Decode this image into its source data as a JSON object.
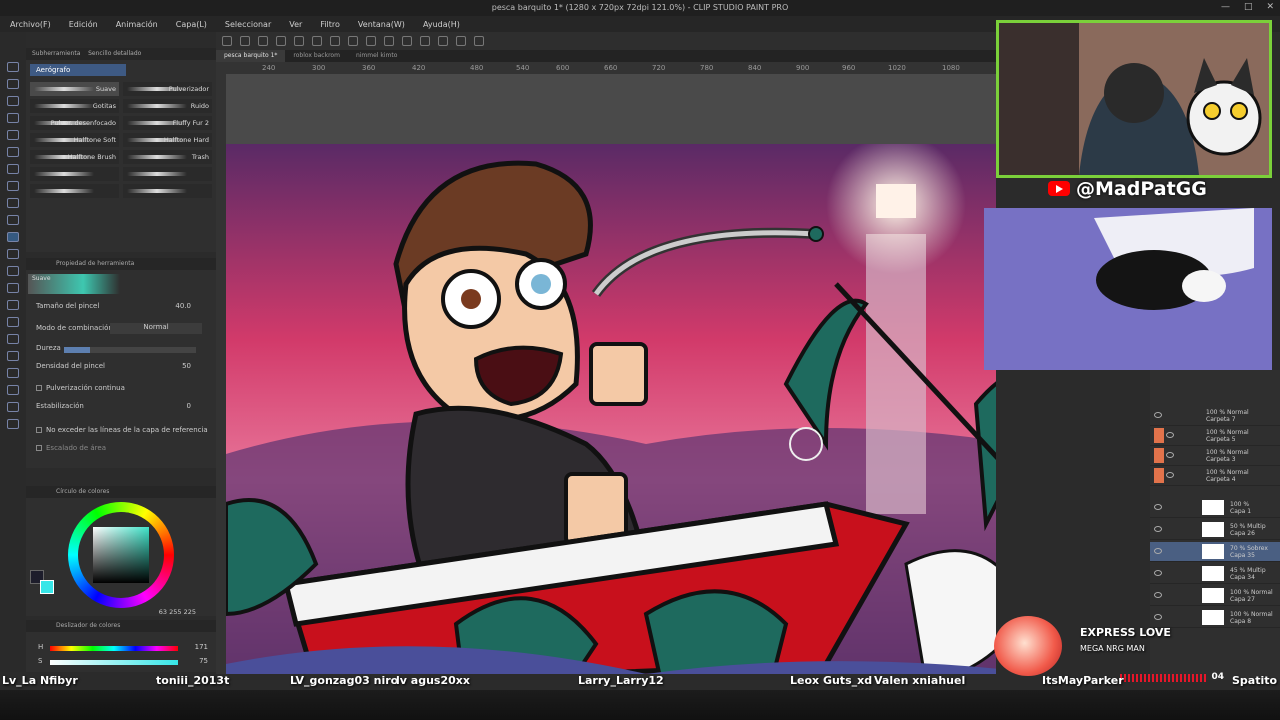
{
  "window": {
    "title": "pesca barquito 1* (1280 x 720px 72dpi 121.0%) - CLIP STUDIO PAINT PRO",
    "controls": [
      "—",
      "□",
      "✕"
    ]
  },
  "menu": [
    "Archivo(F)",
    "Edición",
    "Animación",
    "Capa(L)",
    "Seleccionar",
    "Ver",
    "Filtro",
    "Ventana(W)",
    "Ayuda(H)"
  ],
  "tabs": [
    "pesca barquito 1*",
    "roblox backrom",
    "nimmel kimto"
  ],
  "ruler_ticks": [
    "240",
    "300",
    "360",
    "420",
    "480",
    "540",
    "600",
    "660",
    "720",
    "780",
    "840",
    "900",
    "960",
    "1020",
    "1080"
  ],
  "subtool": {
    "header": "Subherramienta",
    "header2": "Sencillo detallado",
    "group": "Aerógrafo",
    "brushes": [
      {
        "label": "Suave",
        "selected": true
      },
      {
        "label": "Pulverizador",
        "selected": false
      },
      {
        "label": "Gotitas",
        "selected": false
      },
      {
        "label": "Ruido",
        "selected": false
      },
      {
        "label": "Pulver. desenfocado",
        "selected": false
      },
      {
        "label": "Fluffy Fur 2",
        "selected": false
      },
      {
        "label": "Halftone Soft",
        "selected": false
      },
      {
        "label": "Halftone Hard",
        "selected": false
      },
      {
        "label": "Halftone Brush",
        "selected": false
      },
      {
        "label": "Trash",
        "selected": false
      }
    ]
  },
  "tool_property": {
    "header": "Propiedad de herramienta",
    "preview_name": "Suave",
    "brush_size_label": "Tamaño del pincel",
    "brush_size_value": "40.0",
    "blend_mode_label": "Modo de combinación",
    "blend_mode_value": "Normal",
    "hardness_label": "Dureza",
    "hardness_level": 0.2,
    "density_label": "Densidad del pincel",
    "density_value": "50",
    "spray_label": "Pulverización continua",
    "stabilization_label": "Estabilización",
    "stabilization_value": "0",
    "no_exceed_label": "No exceder las líneas de la capa de referencia",
    "area_scale_label": "Escalado de área"
  },
  "color_wheel": {
    "header": "Círculo de colores",
    "h": "63",
    "s": "255",
    "v": "225",
    "main_color": "#36e6e8"
  },
  "color_slider": {
    "header": "Deslizador de colores",
    "rows": [
      {
        "key": "H",
        "value": "171"
      },
      {
        "key": "S",
        "value": "75"
      }
    ]
  },
  "overlay": {
    "handle": "@MadPatGG",
    "alert_title": "EXPRESS LOVE",
    "alert_subtitle": "MEGA NRG MAN",
    "alert_time": "04"
  },
  "chat_names": [
    "Lv_La Nfibyr",
    "toniii_2013t",
    "LV_gonzag03 niro",
    "lv agus20xx",
    "Larry_Larry12",
    "Leox Guts_xd",
    "Valen xniahuel",
    "ItsMayParker",
    "Spatito"
  ],
  "layers": [
    {
      "text1": "100 % Normal",
      "text2": "Carpeta 7",
      "type": "folder"
    },
    {
      "text1": "100 % Normal",
      "text2": "Carpeta 5",
      "type": "folder"
    },
    {
      "text1": "100 % Normal",
      "text2": "Carpeta 3",
      "type": "folder"
    },
    {
      "text1": "100 % Normal",
      "text2": "Carpeta 4",
      "type": "folder"
    },
    {
      "text1": "100 %",
      "text2": "Capa 1",
      "type": "layer"
    },
    {
      "text1": "50 % Multip",
      "text2": "Capa 26",
      "type": "layer"
    },
    {
      "text1": "70 % Sobrex",
      "text2": "Capa 35",
      "type": "layer",
      "selected": true
    },
    {
      "text1": "45 % Multip",
      "text2": "Capa 34",
      "type": "layer"
    },
    {
      "text1": "100 % Normal",
      "text2": "Capa 27",
      "type": "layer"
    },
    {
      "text1": "100 % Normal",
      "text2": "Capa 8",
      "type": "layer"
    }
  ]
}
